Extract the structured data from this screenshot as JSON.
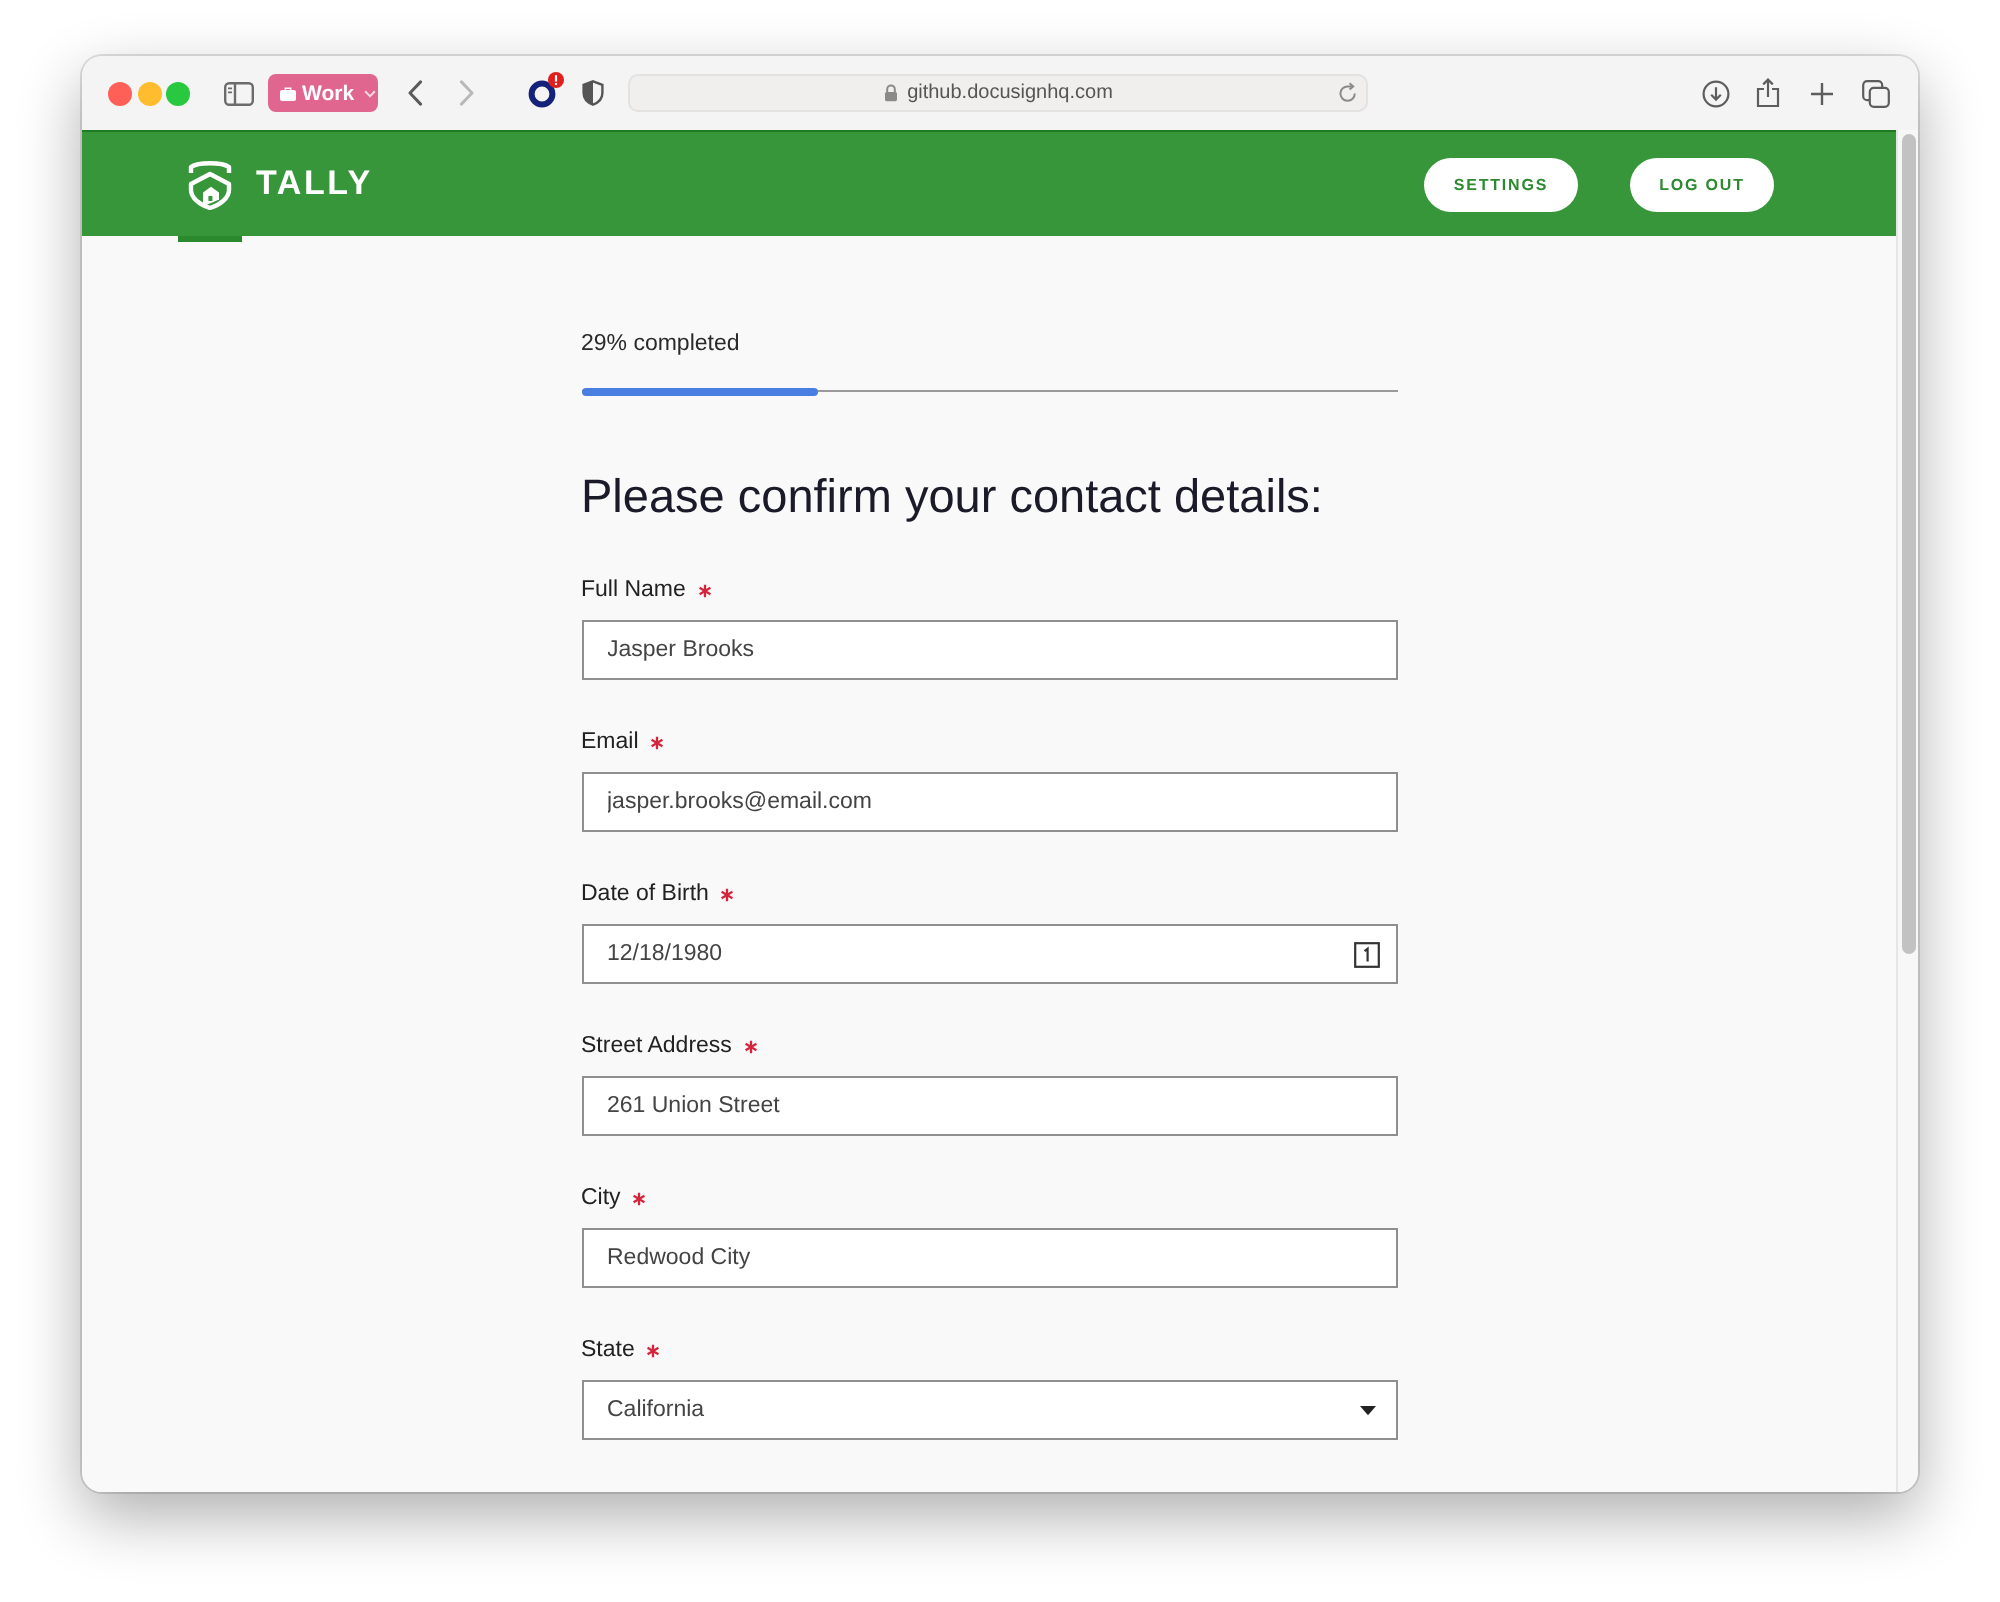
{
  "browser": {
    "tab_group": "Work",
    "address": "github.docusignhq.com",
    "forward_enabled": false
  },
  "header": {
    "brand": "TALLY",
    "buttons": [
      "SETTINGS",
      "LOG OUT"
    ]
  },
  "progress": {
    "label": "29% completed",
    "level": 0.29
  },
  "form": {
    "title": "Please confirm your contact details:",
    "fields": [
      {
        "label": "Full Name",
        "required": true,
        "kind": "text",
        "value": "Jasper Brooks"
      },
      {
        "label": "Email",
        "required": true,
        "kind": "text",
        "value": "jasper.brooks@email.com"
      },
      {
        "label": "Date of Birth",
        "required": true,
        "kind": "date",
        "value": "12/18/1980"
      },
      {
        "label": "Street Address",
        "required": true,
        "kind": "text",
        "value": "261 Union Street"
      },
      {
        "label": "City",
        "required": true,
        "kind": "text",
        "value": "Redwood City"
      },
      {
        "label": "State",
        "required": true,
        "kind": "select",
        "value": "California"
      }
    ]
  }
}
